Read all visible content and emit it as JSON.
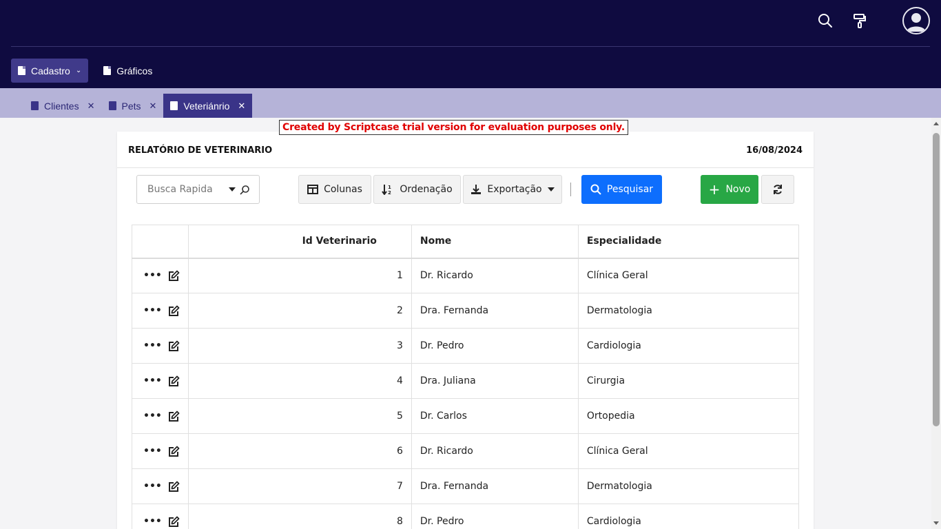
{
  "header": {
    "search_icon": "search-icon",
    "theme_icon": "paint-roller-icon",
    "avatar_icon": "user-avatar-icon",
    "bg_color": "#0f0b40"
  },
  "menu": {
    "items": [
      {
        "label": "Cadastro",
        "icon": "document-icon",
        "dropdown": true
      },
      {
        "label": "Gráficos",
        "icon": "document-icon"
      }
    ]
  },
  "tabs": [
    {
      "label": "Clientes",
      "icon": "document-icon"
    },
    {
      "label": "Pets",
      "icon": "document-icon"
    },
    {
      "label": "Veteriánrio",
      "icon": "document-icon",
      "active": true
    }
  ],
  "trial_notice": "Created by Scriptcase trial version for evaluation purposes only.",
  "report": {
    "title": "RELATÓRIO DE VETERINARIO",
    "date": "16/08/2024"
  },
  "toolbar": {
    "search_placeholder": "Busca Rapida",
    "columns_label": "Colunas",
    "sort_label": "Ordenação",
    "export_label": "Exportação",
    "search_button_label": "Pesquisar",
    "new_button_label": "Novo",
    "refresh_icon": "refresh-icon"
  },
  "table": {
    "columns": [
      "Id Veterinario",
      "Nome",
      "Especialidade"
    ],
    "rows": [
      {
        "id": "1",
        "nome": "Dr. Ricardo",
        "especialidade": "Clínica Geral"
      },
      {
        "id": "2",
        "nome": "Dra. Fernanda",
        "especialidade": "Dermatologia"
      },
      {
        "id": "3",
        "nome": "Dr. Pedro",
        "especialidade": "Cardiologia"
      },
      {
        "id": "4",
        "nome": "Dra. Juliana",
        "especialidade": "Cirurgia"
      },
      {
        "id": "5",
        "nome": "Dr. Carlos",
        "especialidade": "Ortopedia"
      },
      {
        "id": "6",
        "nome": "Dr. Ricardo",
        "especialidade": "Clínica Geral"
      },
      {
        "id": "7",
        "nome": "Dra. Fernanda",
        "especialidade": "Dermatologia"
      },
      {
        "id": "8",
        "nome": "Dr. Pedro",
        "especialidade": "Cardiologia"
      }
    ]
  },
  "colors": {
    "accent": "#0d6efd",
    "success": "#28a745",
    "tabs_bg": "#b5b3d8",
    "tab_active": "#3a3488",
    "trial_text": "#e00000"
  }
}
